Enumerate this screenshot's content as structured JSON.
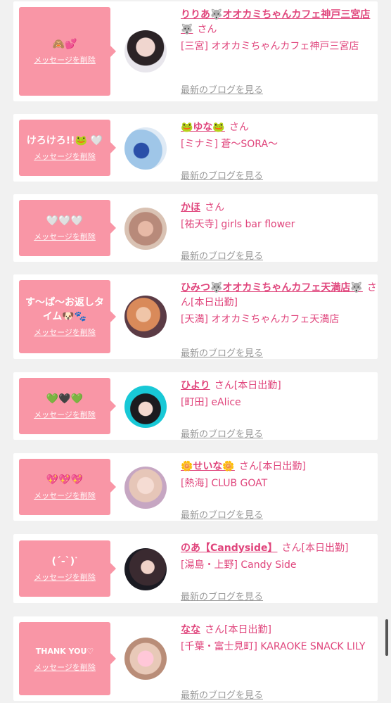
{
  "entries": [
    {
      "message": "🙈💕",
      "delete": "メッセージを削除",
      "name": "りりあ🐺オオカミちゃんカフェ神戸三宮店🐺",
      "san": "さん",
      "shop": "[三宮] オオカミちゃんカフェ神戸三宮店",
      "blog": "最新のブログを見る"
    },
    {
      "message": "けろけろ!!🐸 🤍",
      "delete": "メッセージを削除",
      "name": "🐸ゆな🐸",
      "san": "さん",
      "shop": "[ミナミ] 蒼〜SORA〜",
      "blog": "最新のブログを見る"
    },
    {
      "message": "🤍🤍🤍",
      "delete": "メッセージを削除",
      "name": "かほ",
      "san": "さん",
      "shop": "[祐天寺] girls bar flower",
      "blog": "最新のブログを見る"
    },
    {
      "message": "す〜ぱ〜お返しタイム🐶🐾",
      "delete": "メッセージを削除",
      "name": "ひみつ🐺オオカミちゃんカフェ天満店🐺",
      "san": "さん[本日出勤]",
      "shop": "[天満] オオカミちゃんカフェ天満店",
      "blog": "最新のブログを見る"
    },
    {
      "message": "💚🖤💚",
      "delete": "メッセージを削除",
      "name": "ひより",
      "san": "さん[本日出勤]",
      "shop": "[町田] eAlice",
      "blog": "最新のブログを見る"
    },
    {
      "message": "💖💖💖",
      "delete": "メッセージを削除",
      "name": "🌼せいな🌼",
      "san": "さん[本日出勤]",
      "shop": "[熱海] CLUB GOAT",
      "blog": "最新のブログを見る"
    },
    {
      "message": "(ˊ-ˋ)ᐝ",
      "delete": "メッセージを削除",
      "name": "のあ【Candyside】",
      "san": "さん[本日出勤]",
      "shop": "[湯島・上野] Candy Side",
      "blog": "最新のブログを見る"
    },
    {
      "message": "THANK YOU♡",
      "delete": "メッセージを削除",
      "name": "なな",
      "san": "さん[本日出勤]",
      "shop": "[千葉・富士見町] KARAOKE SNACK LILY",
      "blog": "最新のブログを見る"
    }
  ],
  "colors": {
    "accent": "#e0457c",
    "bubble": "#f996a6",
    "muted": "#9a9a9a",
    "background": "#f1f1f1"
  }
}
